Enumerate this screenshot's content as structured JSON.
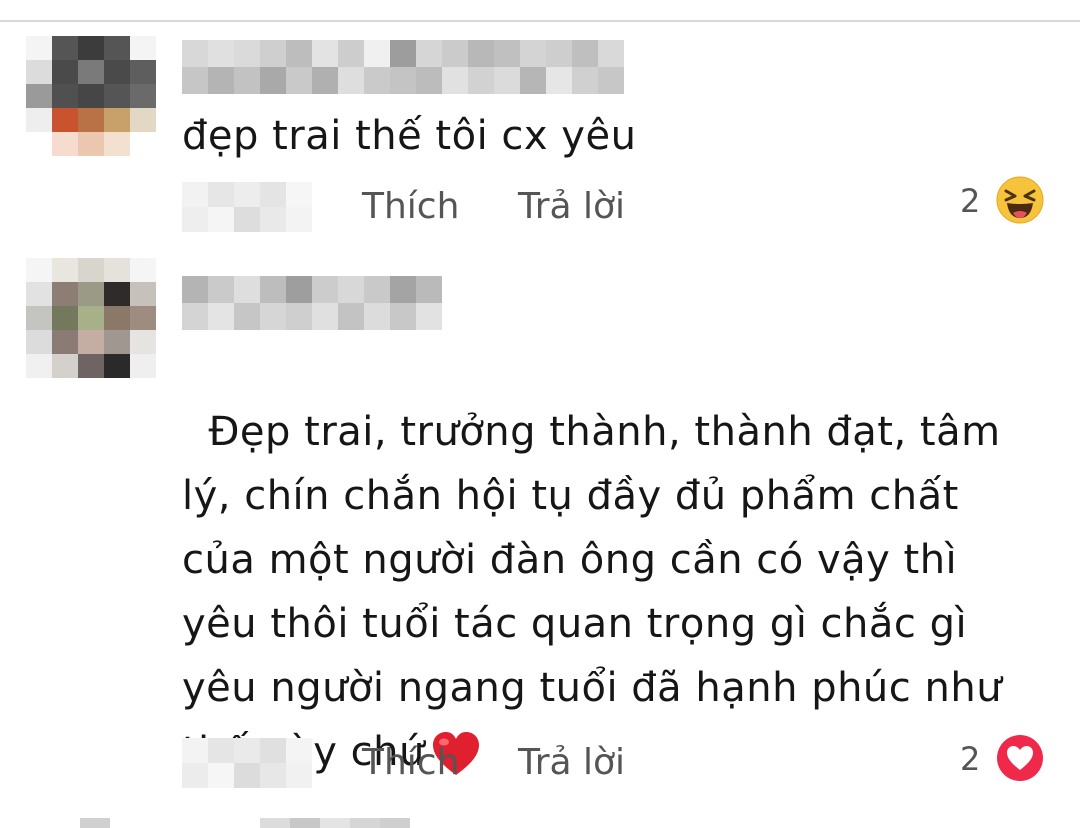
{
  "comments": [
    {
      "text": "đẹp trai thế tôi cx yêu",
      "like_label": "Thích",
      "reply_label": "Trả lời",
      "reaction_count": "2",
      "reaction_icon": "laughing-emoji-icon"
    },
    {
      "text": "Đẹp trai, trưởng thành, thành đạt, tâm lý, chín chắn hội tụ đầy đủ phẩm chất của một người đàn ông cần có vậy thì yêu thôi tuổi tác quan trọng gì chắc gì yêu người ngang tuổi đã hạnh phúc như thế này chứ",
      "like_label": "Thích",
      "reply_label": "Trả lời",
      "reaction_count": "2",
      "reaction_icon": "love-reaction-icon"
    }
  ],
  "colors": {
    "reaction_love": "#f0284a",
    "reaction_haha": "#f7b125",
    "action_text": "#555555"
  }
}
